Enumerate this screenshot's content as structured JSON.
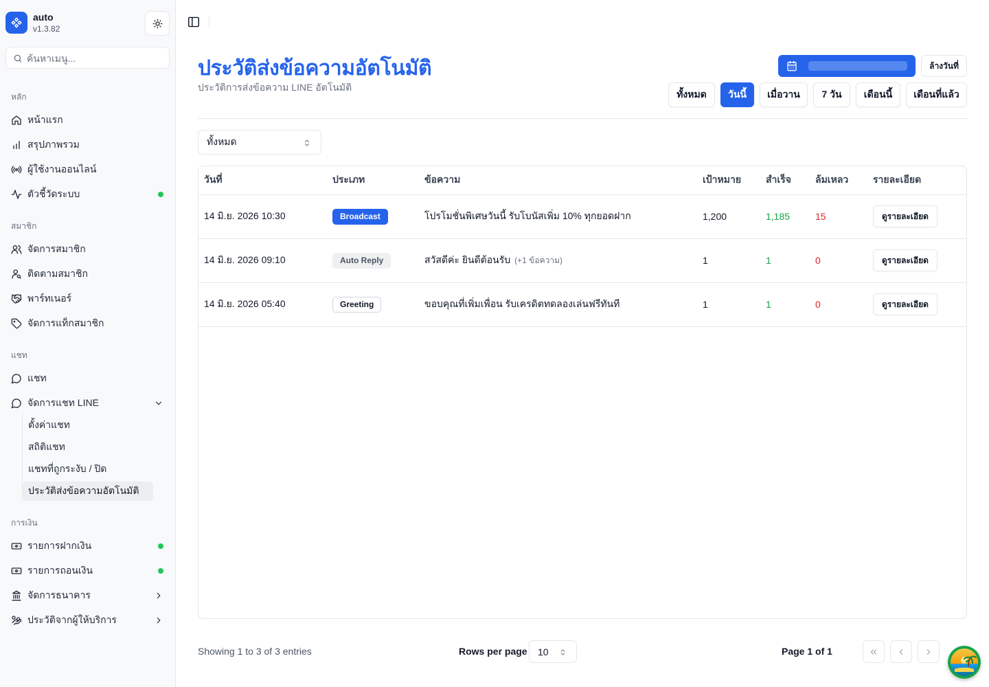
{
  "brand": {
    "name": "auto",
    "version": "v1.3.82"
  },
  "search": {
    "placeholder": "ค้นหาเมนู..."
  },
  "sidebar": {
    "groups": [
      {
        "label": "หลัก"
      },
      {
        "label": "สมาชิก"
      },
      {
        "label": "แชท"
      },
      {
        "label": "การเงิน"
      }
    ],
    "items": [
      {
        "label": "หน้าแรก",
        "icon": "home-icon"
      },
      {
        "label": "สรุปภาพรวม",
        "icon": "bar-chart-icon"
      },
      {
        "label": "ผู้ใช้งานออนไลน์",
        "icon": "radio-icon"
      },
      {
        "label": "ตัวชี้วัดระบบ",
        "icon": "activity-icon",
        "status": "online"
      },
      {
        "label": "จัดการสมาชิก",
        "icon": "users-icon"
      },
      {
        "label": "ติดตามสมาชิก",
        "icon": "user-search-icon"
      },
      {
        "label": "พาร์ทเนอร์",
        "icon": "handshake-icon"
      },
      {
        "label": "จัดการแท็กสมาชิก",
        "icon": "tag-icon"
      },
      {
        "label": "แชท",
        "icon": "message-circle-icon"
      },
      {
        "label": "จัดการแชท LINE",
        "icon": "message-circle-icon",
        "expanded": true
      },
      {
        "label": "รายการฝากเงิน",
        "icon": "deposit-icon",
        "status": "online"
      },
      {
        "label": "รายการถอนเงิน",
        "icon": "withdraw-icon",
        "status": "online"
      },
      {
        "label": "จัดการธนาคาร",
        "icon": "bank-icon"
      },
      {
        "label": "ประวัติจากผู้ให้บริการ",
        "icon": "hand-coins-icon"
      }
    ],
    "sub_items": [
      {
        "label": "ตั้งค่าแชท"
      },
      {
        "label": "สถิติแชท"
      },
      {
        "label": "แชทที่ถูกระงับ / ปิด"
      },
      {
        "label": "ประวัติส่งข้อความอัตโนมัติ",
        "active": true
      }
    ]
  },
  "page": {
    "title": "ประวัติส่งข้อความอัตโนมัติ",
    "subtitle": "ประวัติการส่งข้อความ LINE อัตโนมัติ",
    "clear_date_label": "ล้างวันที่",
    "ranges": [
      "ทั้งหมด",
      "วันนี้",
      "เมื่อวาน",
      "7 วัน",
      "เดือนนี้",
      "เดือนที่แล้ว"
    ],
    "active_range": "วันนี้",
    "filter_value": "ทั้งหมด"
  },
  "table": {
    "headers": [
      "วันที่",
      "ประเภท",
      "ข้อความ",
      "เป้าหมาย",
      "สำเร็จ",
      "ล้มเหลว",
      "รายละเอียด"
    ],
    "detail_label": "ดูรายละเอียด",
    "rows": [
      {
        "date": "14 มิ.ย. 2026 10:30",
        "type": "Broadcast",
        "message": "โปรโมชั่นพิเศษวันนี้ รับโบนัสเพิ่ม 10% ทุกยอดฝาก",
        "extra": "",
        "target": "1,200",
        "success": "1,185",
        "failed": "15"
      },
      {
        "date": "14 มิ.ย. 2026 09:10",
        "type": "Auto Reply",
        "message": "สวัสดีค่ะ ยินดีต้อนรับ",
        "extra": "(+1 ข้อความ)",
        "target": "1",
        "success": "1",
        "failed": "0"
      },
      {
        "date": "14 มิ.ย. 2026 05:40",
        "type": "Greeting",
        "message": "ขอบคุณที่เพิ่มเพื่อน รับเครดิตทดลองเล่นฟรีทันที",
        "extra": "",
        "target": "1",
        "success": "1",
        "failed": "0"
      }
    ]
  },
  "footer": {
    "showing": "Showing 1 to 3 of 3 entries",
    "rows_per_page_label": "Rows per page",
    "rows_per_page_value": "10",
    "page_label": "Page 1 of 1"
  },
  "colors": {
    "accent": "#2563eb",
    "success": "#16a34a",
    "danger": "#dc2626",
    "status_dot": "#22c55e"
  }
}
